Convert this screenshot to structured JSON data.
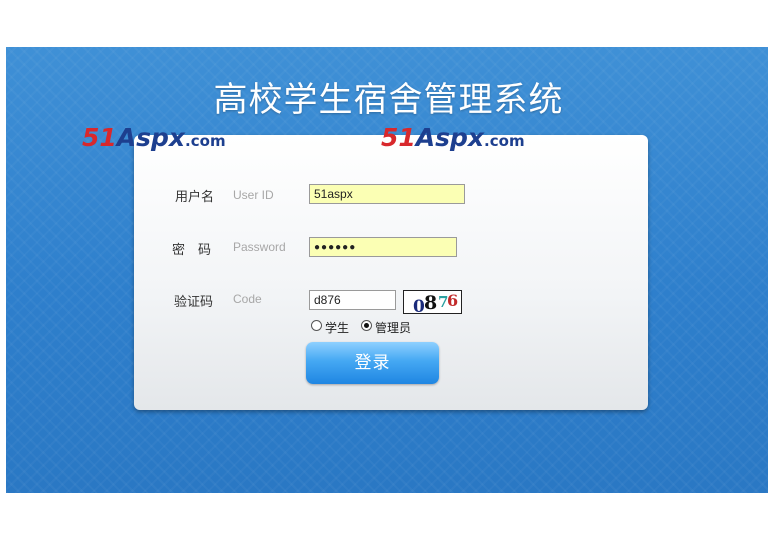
{
  "page": {
    "title": "高校学生宿舍管理系统"
  },
  "watermarks": [
    {
      "num": "51",
      "word": "Aspx",
      "domain": ".com"
    },
    {
      "num": "51",
      "word": "Aspx",
      "domain": ".com"
    }
  ],
  "form": {
    "username": {
      "label": "用户名",
      "sub_label": "User ID",
      "value": "51aspx"
    },
    "password": {
      "label": "密　码",
      "sub_label": "Password",
      "value": "●●●●●●"
    },
    "code": {
      "label": "验证码",
      "sub_label": "Code",
      "value": "d876",
      "captcha_chars": [
        "0",
        "8",
        "7",
        "6"
      ]
    },
    "role": {
      "options": [
        {
          "label": "学生",
          "selected": false
        },
        {
          "label": "管理员",
          "selected": true
        }
      ]
    },
    "login_label": "登录"
  },
  "colors": {
    "background": "#2e7fcc",
    "button": "#2b8ee8",
    "input_fill": "#fbffb4",
    "brand_red": "#d8282c",
    "brand_blue": "#1d3f8f"
  }
}
